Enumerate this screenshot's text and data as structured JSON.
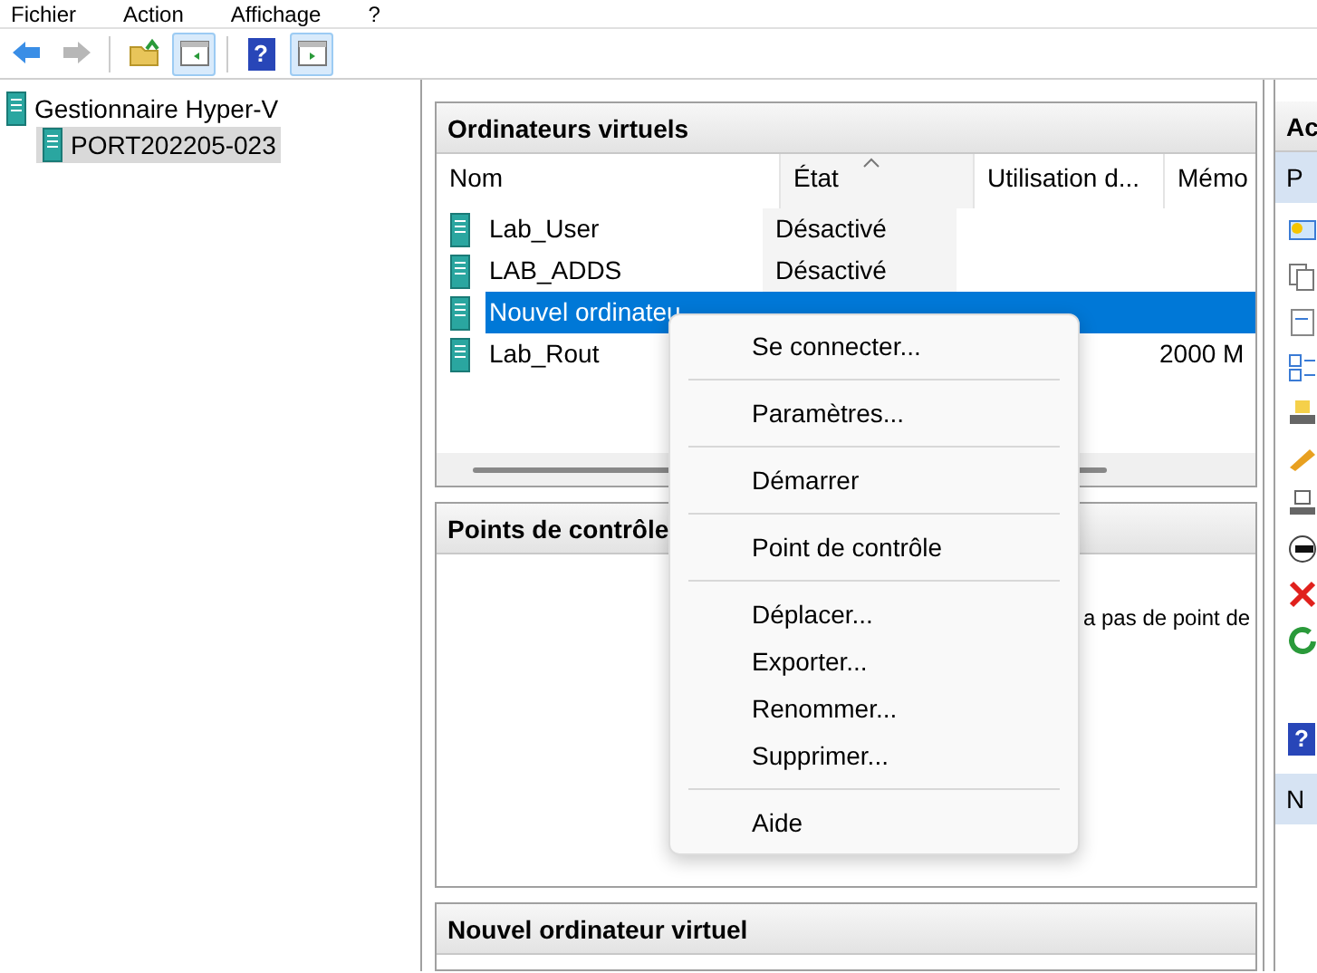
{
  "menu_bar": [
    "Fichier",
    "Action",
    "Affichage",
    "?"
  ],
  "toolbar": [
    {
      "kind": "back",
      "pressed": false,
      "disabled": false
    },
    {
      "kind": "forward",
      "pressed": false,
      "disabled": true
    },
    {
      "kind": "up",
      "pressed": false,
      "disabled": false
    },
    {
      "kind": "tree",
      "pressed": true,
      "disabled": false
    },
    {
      "kind": "help",
      "glyph": "?",
      "pressed": false,
      "disabled": false
    },
    {
      "kind": "actions",
      "pressed": true,
      "disabled": false
    }
  ],
  "tree": [
    {
      "label": "Gestionnaire Hyper-V",
      "selected": false,
      "children": [
        {
          "label": "PORT202205-023",
          "selected": true
        }
      ]
    }
  ],
  "vm_panel": {
    "title": "Ordinateurs virtuels",
    "columns": [
      {
        "label": "Nom",
        "sorted": false
      },
      {
        "label": "État",
        "sorted": true
      },
      {
        "label": "Utilisation d...",
        "sorted": false
      },
      {
        "label": "Mémo",
        "sorted": false
      }
    ],
    "rows": [
      {
        "name": "Lab_User",
        "state": "Désactivé",
        "usage": "",
        "memory": "",
        "selected": false
      },
      {
        "name": "LAB_ADDS",
        "state": "Désactivé",
        "usage": "",
        "memory": "",
        "selected": false
      },
      {
        "name": "Nouvel ordinateu",
        "state": "",
        "usage": "",
        "memory": "",
        "selected": true
      },
      {
        "name": "Lab_Rout",
        "state": "",
        "usage": "",
        "memory": "2000 M",
        "selected": false
      }
    ]
  },
  "checkpoints_panel": {
    "title": "Points de contrôle",
    "message": "a pas de point de"
  },
  "details_panel": {
    "title": "Nouvel ordinateur virtuel"
  },
  "actions_pane": {
    "title": "Ac",
    "section": "P",
    "section_2": "N",
    "help_glyph": "?"
  },
  "context_menu": [
    {
      "kind": "item",
      "label": "Se connecter..."
    },
    {
      "kind": "separator"
    },
    {
      "kind": "item",
      "label": "Paramètres..."
    },
    {
      "kind": "separator"
    },
    {
      "kind": "item",
      "label": "Démarrer"
    },
    {
      "kind": "separator"
    },
    {
      "kind": "item",
      "label": "Point de contrôle"
    },
    {
      "kind": "separator"
    },
    {
      "kind": "item",
      "label": "Déplacer..."
    },
    {
      "kind": "item",
      "label": "Exporter..."
    },
    {
      "kind": "item",
      "label": "Renommer..."
    },
    {
      "kind": "item",
      "label": "Supprimer..."
    },
    {
      "kind": "separator"
    },
    {
      "kind": "item",
      "label": "Aide"
    }
  ]
}
